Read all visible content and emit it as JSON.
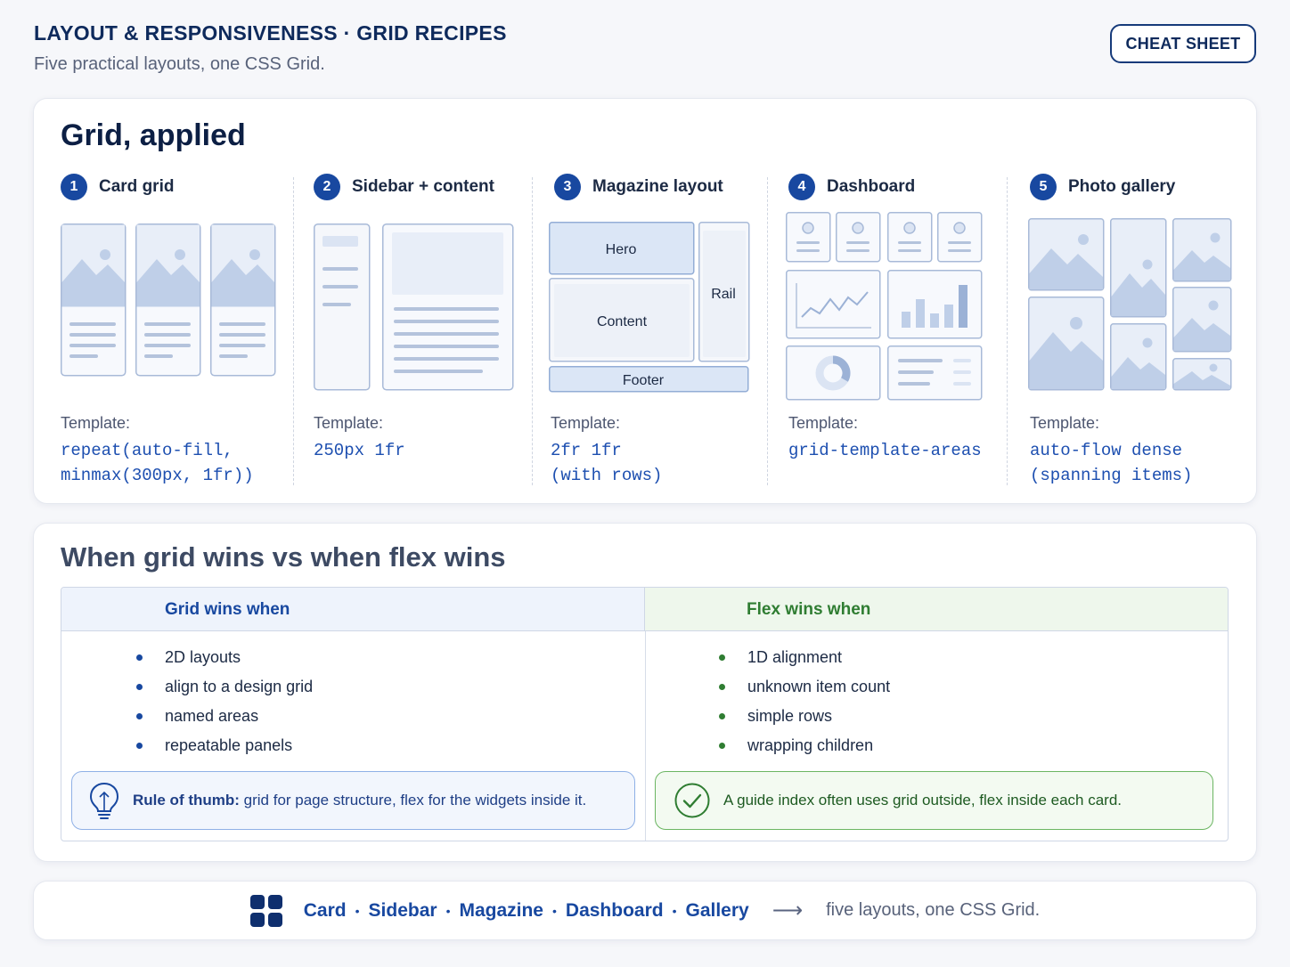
{
  "header": {
    "title": "LAYOUT & RESPONSIVENESS · GRID RECIPES",
    "subtitle": "Five practical layouts, one CSS Grid.",
    "button_label": "CHEAT SHEET"
  },
  "applied": {
    "title": "Grid, applied",
    "recipes": [
      {
        "number": "1",
        "label": "Card grid",
        "template_label": "Template:",
        "template_code": "repeat(auto-fill,\nminmax(300px, 1fr))"
      },
      {
        "number": "2",
        "label": "Sidebar + content",
        "template_label": "Template:",
        "template_code": "250px 1fr"
      },
      {
        "number": "3",
        "label": "Magazine layout",
        "template_label": "Template:",
        "template_code": "2fr 1fr\n(with rows)"
      },
      {
        "number": "4",
        "label": "Dashboard",
        "template_label": "Template:",
        "template_code": "grid-template-areas"
      },
      {
        "number": "5",
        "label": "Photo gallery",
        "template_label": "Template:",
        "template_code": "auto-flow dense\n(spanning items)"
      }
    ],
    "magazine_labels": {
      "hero": "Hero",
      "rail": "Rail",
      "content": "Content",
      "footer": "Footer"
    }
  },
  "compare": {
    "title": "When grid wins vs when flex wins",
    "grid_header": "Grid wins when",
    "flex_header": "Flex wins when",
    "grid_items": [
      "2D layouts",
      "align to a design grid",
      "named areas",
      "repeatable panels"
    ],
    "flex_items": [
      "1D alignment",
      "unknown item count",
      "simple rows",
      "wrapping children"
    ],
    "tip_left_bold": "Rule of thumb:",
    "tip_left_text": " grid for page structure, flex for the widgets inside it.",
    "tip_right_text": "A guide index often uses grid outside, flex inside each card."
  },
  "footer": {
    "links": [
      "Card",
      "Sidebar",
      "Magazine",
      "Dashboard",
      "Gallery"
    ],
    "separator": "•",
    "arrow": "⟶",
    "tagline": "five layouts, one CSS Grid."
  },
  "colors": {
    "accent_blue": "#1848a0",
    "grid_green": "#2f7d32",
    "illustration_fill": "#dbe4f3",
    "illustration_stroke": "#a8bad8"
  },
  "icons": [
    "lightbulb-icon",
    "check-circle-icon",
    "grid-logo-icon"
  ]
}
